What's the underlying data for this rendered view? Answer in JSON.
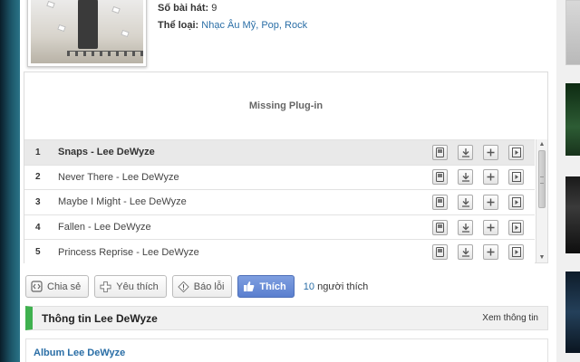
{
  "album": {
    "song_count_label": "Số bài hát:",
    "song_count": "9",
    "genre_label": "Thể loại:",
    "genres": "Nhạc Âu Mỹ, Pop, Rock"
  },
  "player": {
    "plugin_message": "Missing Plug-in",
    "tracks": [
      {
        "num": "1",
        "title": "Snaps - Lee DeWyze"
      },
      {
        "num": "2",
        "title": "Never There - Lee DeWyze"
      },
      {
        "num": "3",
        "title": "Maybe I Might - Lee DeWyze"
      },
      {
        "num": "4",
        "title": "Fallen - Lee DeWyze"
      },
      {
        "num": "5",
        "title": "Princess Reprise - Lee DeWyze"
      }
    ],
    "active_track_index": 0
  },
  "social": {
    "share_label": "Chia sẻ",
    "favorite_label": "Yêu thích",
    "report_label": "Báo lỗi",
    "like_label": "Thích",
    "like_count": "10",
    "like_suffix": "người thích"
  },
  "info": {
    "title": "Thông tin Lee DeWyze",
    "more_link": "Xem thông tin",
    "album_heading": "Album Lee DeWyze"
  },
  "colors": {
    "accent_green": "#3fb14f",
    "link_blue": "#2a6ea6",
    "like_blue": "#5a7fcf"
  }
}
